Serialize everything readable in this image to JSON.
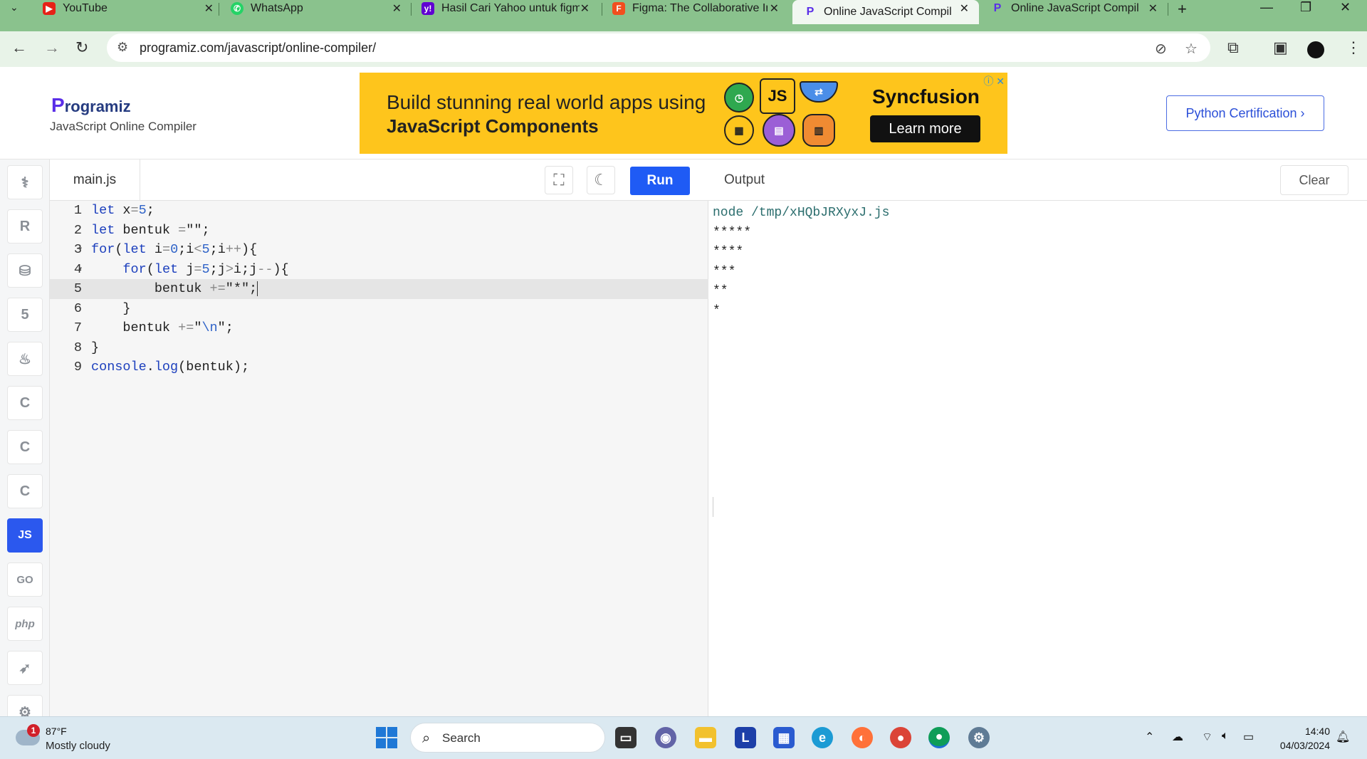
{
  "browser": {
    "tabs": [
      {
        "title": "YouTube",
        "icon": "youtube-icon",
        "color": "#e62117"
      },
      {
        "title": "WhatsApp",
        "icon": "whatsapp-icon",
        "color": "#25d366"
      },
      {
        "title": "Hasil Cari Yahoo untuk figma",
        "icon": "yahoo-icon",
        "color": "#6001d2"
      },
      {
        "title": "Figma: The Collaborative Interface",
        "icon": "figma-icon",
        "color": "#f24e1e"
      },
      {
        "title": "Online JavaScript Compiler",
        "icon": "programiz-icon",
        "color": "#5a2ee8"
      },
      {
        "title": "Online JavaScript Compiler",
        "icon": "programiz-icon",
        "color": "#5a2ee8"
      }
    ],
    "url": "programiz.com/javascript/online-compiler/"
  },
  "header": {
    "logo_text": "rogramiz",
    "logo_letter": "P",
    "subtitle": "JavaScript Online Compiler",
    "ad": {
      "line1": "Build stunning real world apps using",
      "line2": "JavaScript Components",
      "brand": "Syncfusion",
      "cta": "Learn more",
      "js_badge": "JS"
    },
    "cert_button": "Python Certification ›"
  },
  "languages": [
    "python",
    "r",
    "sql",
    "html",
    "java",
    "c",
    "cpp",
    "csharp",
    "js",
    "go",
    "php",
    "swift",
    "rust"
  ],
  "languages_labels": {
    "js": "JS",
    "go": "GO",
    "php": "php"
  },
  "editor": {
    "filename": "main.js",
    "run_label": "Run",
    "lines": [
      {
        "n": "1",
        "text": "let x=5;"
      },
      {
        "n": "2",
        "text": "let bentuk =\"\";"
      },
      {
        "n": "3",
        "text": "for(let i=0;i<5;i++){"
      },
      {
        "n": "4",
        "text": "    for(let j=5;j>i;j--){"
      },
      {
        "n": "5",
        "text": "        bentuk +=\"*\";"
      },
      {
        "n": "6",
        "text": "    }"
      },
      {
        "n": "7",
        "text": "    bentuk +=\"\\n\";"
      },
      {
        "n": "8",
        "text": "}"
      },
      {
        "n": "9",
        "text": "console.log(bentuk);"
      }
    ]
  },
  "output": {
    "title": "Output",
    "clear_label": "Clear",
    "command": "node /tmp/xHQbJRXyxJ.js",
    "lines": [
      "*****",
      "****",
      "***",
      "**",
      "*"
    ]
  },
  "taskbar": {
    "weather_temp": "87°F",
    "weather_cond": "Mostly cloudy",
    "weather_badge": "1",
    "search_label": "Search",
    "time": "14:40",
    "date": "04/03/2024"
  }
}
